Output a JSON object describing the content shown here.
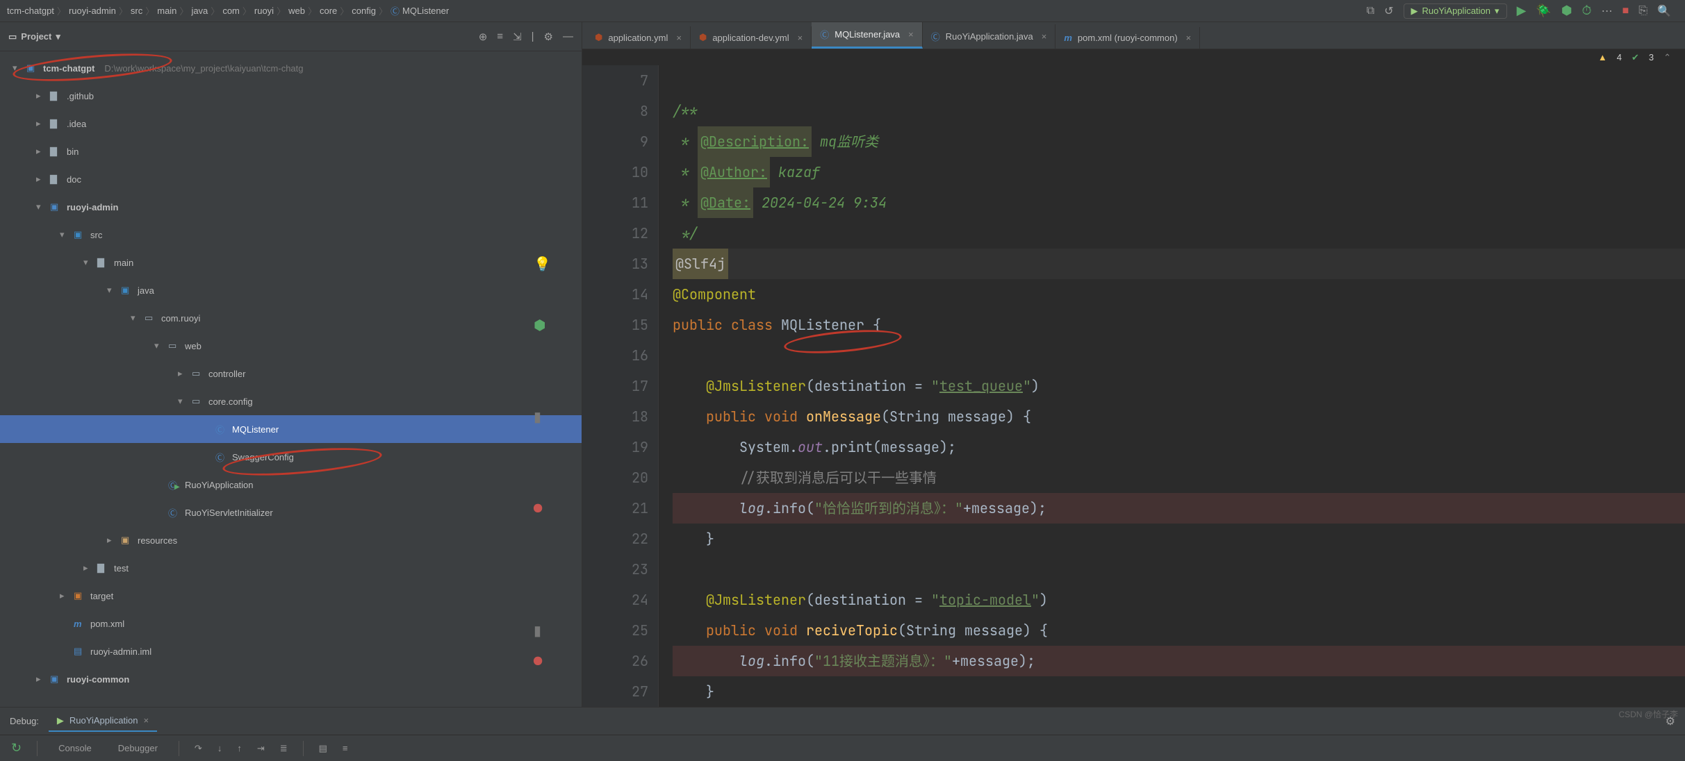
{
  "breadcrumbs": [
    "tcm-chatgpt",
    "ruoyi-admin",
    "src",
    "main",
    "java",
    "com",
    "ruoyi",
    "web",
    "core",
    "config",
    "MQListener"
  ],
  "runConfig": "RuoYiApplication",
  "projectHeader": {
    "title": "Project"
  },
  "tree": {
    "root": {
      "name": "tcm-chatgpt",
      "path": "D:\\work\\workspace\\my_project\\kaiyuan\\tcm-chatg"
    },
    "items": [
      {
        "name": ".github",
        "depth": 1,
        "kind": "folder",
        "expanded": false
      },
      {
        "name": ".idea",
        "depth": 1,
        "kind": "folder",
        "expanded": false
      },
      {
        "name": "bin",
        "depth": 1,
        "kind": "folder",
        "expanded": false
      },
      {
        "name": "doc",
        "depth": 1,
        "kind": "folder",
        "expanded": false
      },
      {
        "name": "ruoyi-admin",
        "depth": 1,
        "kind": "module",
        "expanded": true
      },
      {
        "name": "src",
        "depth": 2,
        "kind": "src",
        "expanded": true
      },
      {
        "name": "main",
        "depth": 3,
        "kind": "folder",
        "expanded": true
      },
      {
        "name": "java",
        "depth": 4,
        "kind": "src",
        "expanded": true
      },
      {
        "name": "com.ruoyi",
        "depth": 5,
        "kind": "pkg",
        "expanded": true
      },
      {
        "name": "web",
        "depth": 6,
        "kind": "pkg",
        "expanded": true
      },
      {
        "name": "controller",
        "depth": 7,
        "kind": "pkg",
        "expanded": false
      },
      {
        "name": "core.config",
        "depth": 7,
        "kind": "pkg",
        "expanded": true
      },
      {
        "name": "MQListener",
        "depth": 8,
        "kind": "class",
        "selected": true
      },
      {
        "name": "SwaggerConfig",
        "depth": 8,
        "kind": "class"
      },
      {
        "name": "RuoYiApplication",
        "depth": 6,
        "kind": "class-run"
      },
      {
        "name": "RuoYiServletInitializer",
        "depth": 6,
        "kind": "class"
      },
      {
        "name": "resources",
        "depth": 4,
        "kind": "res",
        "expanded": false
      },
      {
        "name": "test",
        "depth": 3,
        "kind": "folder",
        "expanded": false
      },
      {
        "name": "target",
        "depth": 2,
        "kind": "target",
        "expanded": false
      },
      {
        "name": "pom.xml",
        "depth": 2,
        "kind": "pom"
      },
      {
        "name": "ruoyi-admin.iml",
        "depth": 2,
        "kind": "iml"
      },
      {
        "name": "ruoyi-common",
        "depth": 1,
        "kind": "module",
        "expanded": false
      }
    ]
  },
  "editorTabs": [
    {
      "label": "application.yml",
      "kind": "yml"
    },
    {
      "label": "application-dev.yml",
      "kind": "yml"
    },
    {
      "label": "MQListener.java",
      "kind": "java",
      "active": true
    },
    {
      "label": "RuoYiApplication.java",
      "kind": "java"
    },
    {
      "label": "pom.xml (ruoyi-common)",
      "kind": "pom"
    }
  ],
  "inspections": {
    "warnings": "4",
    "checks": "3"
  },
  "gutterIcons": {
    "13": "bulb",
    "15": "component",
    "18": "bar",
    "21": "dot-red",
    "25": "bar",
    "26": "dot-red"
  },
  "code": {
    "start": 7,
    "lines": [
      {
        "n": 7,
        "segs": [
          {
            "t": "",
            "c": ""
          }
        ]
      },
      {
        "n": 8,
        "segs": [
          {
            "t": "/**",
            "c": "doc"
          }
        ]
      },
      {
        "n": 9,
        "segs": [
          {
            "t": " * ",
            "c": "doc"
          },
          {
            "t": "@Description:",
            "c": "docTag"
          },
          {
            "t": " mq监听类",
            "c": "doc"
          }
        ]
      },
      {
        "n": 10,
        "segs": [
          {
            "t": " * ",
            "c": "doc"
          },
          {
            "t": "@Author:",
            "c": "docTag"
          },
          {
            "t": " kazaf",
            "c": "doc"
          }
        ]
      },
      {
        "n": 11,
        "segs": [
          {
            "t": " * ",
            "c": "doc"
          },
          {
            "t": "@Date:",
            "c": "docTag"
          },
          {
            "t": " 2024-04-24 9:34",
            "c": "doc"
          }
        ]
      },
      {
        "n": 12,
        "segs": [
          {
            "t": " */",
            "c": "doc"
          }
        ]
      },
      {
        "n": 13,
        "caret": true,
        "segs": [
          {
            "t": "@Slf4j",
            "c": "ann"
          }
        ]
      },
      {
        "n": 14,
        "segs": [
          {
            "t": "@Component",
            "c": "ann2"
          }
        ]
      },
      {
        "n": 15,
        "segs": [
          {
            "t": "public class ",
            "c": "kw"
          },
          {
            "t": "MQListener",
            "c": "type"
          },
          {
            "t": " {",
            "c": ""
          }
        ]
      },
      {
        "n": 16,
        "segs": [
          {
            "t": "",
            "c": ""
          }
        ]
      },
      {
        "n": 17,
        "segs": [
          {
            "t": "    @JmsListener",
            "c": "ann2"
          },
          {
            "t": "(destination = ",
            "c": ""
          },
          {
            "t": "\"",
            "c": "str"
          },
          {
            "t": "test_queue",
            "c": "strU"
          },
          {
            "t": "\"",
            "c": "str"
          },
          {
            "t": ")",
            "c": ""
          }
        ]
      },
      {
        "n": 18,
        "segs": [
          {
            "t": "    public void ",
            "c": "kw"
          },
          {
            "t": "onMessage",
            "c": "fn"
          },
          {
            "t": "(String message) {",
            "c": ""
          }
        ]
      },
      {
        "n": 19,
        "segs": [
          {
            "t": "        System.",
            "c": ""
          },
          {
            "t": "out",
            "c": "field"
          },
          {
            "t": ".print(message);",
            "c": ""
          }
        ]
      },
      {
        "n": 20,
        "segs": [
          {
            "t": "        //获取到消息后可以干一些事情",
            "c": "cmt"
          }
        ]
      },
      {
        "n": 21,
        "hl": true,
        "segs": [
          {
            "t": "        ",
            "c": ""
          },
          {
            "t": "log",
            "c": "ital"
          },
          {
            "t": ".info(",
            "c": ""
          },
          {
            "t": "\"恰恰监听到的消息》：\"",
            "c": "str"
          },
          {
            "t": "+message);",
            "c": ""
          }
        ]
      },
      {
        "n": 22,
        "segs": [
          {
            "t": "    }",
            "c": ""
          }
        ]
      },
      {
        "n": 23,
        "segs": [
          {
            "t": "",
            "c": ""
          }
        ]
      },
      {
        "n": 24,
        "segs": [
          {
            "t": "    @JmsListener",
            "c": "ann2"
          },
          {
            "t": "(destination = ",
            "c": ""
          },
          {
            "t": "\"",
            "c": "str"
          },
          {
            "t": "topic-model",
            "c": "strU"
          },
          {
            "t": "\"",
            "c": "str"
          },
          {
            "t": ")",
            "c": ""
          }
        ]
      },
      {
        "n": 25,
        "segs": [
          {
            "t": "    public void ",
            "c": "kw"
          },
          {
            "t": "reciveTopic",
            "c": "fn"
          },
          {
            "t": "(String message) {",
            "c": ""
          }
        ]
      },
      {
        "n": 26,
        "hl": true,
        "segs": [
          {
            "t": "        ",
            "c": ""
          },
          {
            "t": "log",
            "c": "ital"
          },
          {
            "t": ".info(",
            "c": ""
          },
          {
            "t": "\"11接收主题消息》：\"",
            "c": "str"
          },
          {
            "t": "+message);",
            "c": ""
          }
        ]
      },
      {
        "n": 27,
        "segs": [
          {
            "t": "    }",
            "c": ""
          }
        ]
      }
    ]
  },
  "debug": {
    "label": "Debug:",
    "session": "RuoYiApplication",
    "subtabs": [
      "Console",
      "Debugger"
    ]
  },
  "watermark": "CSDN @恰子李"
}
